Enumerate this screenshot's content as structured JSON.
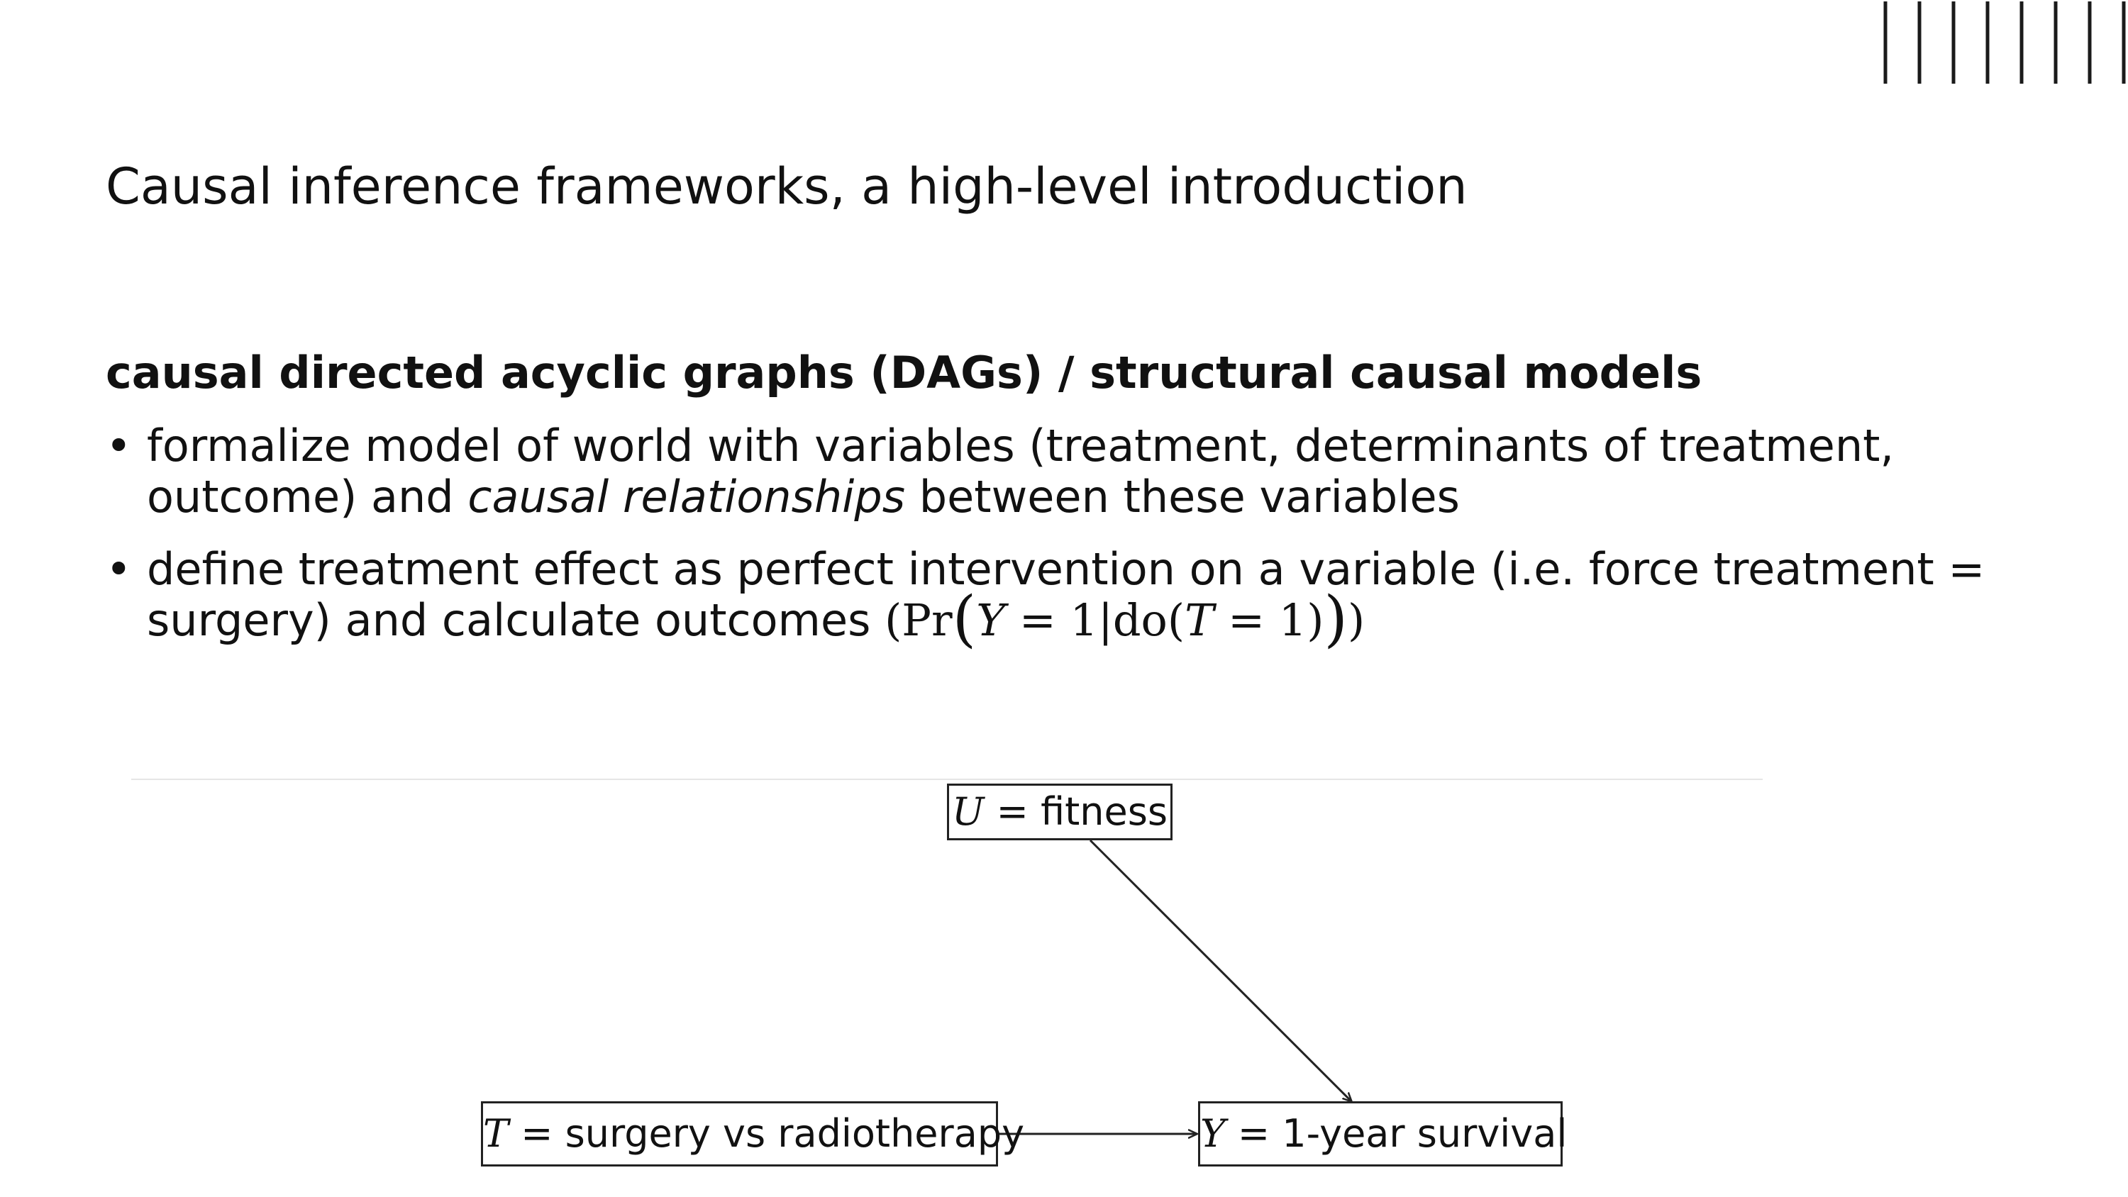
{
  "slide": {
    "title": "Causal inference frameworks, a high-level introduction",
    "section_heading": "causal directed acyclic graphs (DAGs) / structural causal models",
    "bullets": [
      {
        "text_before": "formalize model of world with variables (treatment, determinants of treatment, outcome) and ",
        "emphasis": "causal relationships",
        "text_after": " between these variables"
      },
      {
        "text_before": "define treatment effect as perfect intervention on a variable (i.e. force treatment = surgery) and calculate outcomes ",
        "formula": {
          "open": "(Pr",
          "lparen": "(",
          "Y": "Y",
          "mid1": " = 1|do(",
          "T": "T",
          "mid2": " = 1)",
          "rparen": ")",
          "close": ")"
        }
      }
    ]
  },
  "dag": {
    "nodes": {
      "u": {
        "var": "U",
        "label": " = fitness"
      },
      "t": {
        "var": "T",
        "label": " = surgery vs radiotherapy"
      },
      "y": {
        "var": "Y",
        "label": " = 1-year survival"
      }
    },
    "edges": [
      {
        "from": "U",
        "to": "Y"
      },
      {
        "from": "T",
        "to": "Y"
      }
    ]
  },
  "colors": {
    "text": "#111111",
    "node_border": "#222222",
    "divider": "#e6e6e6",
    "logo": "#1a1a1a"
  },
  "logo": {
    "icon": "vertical-bars-logo"
  }
}
